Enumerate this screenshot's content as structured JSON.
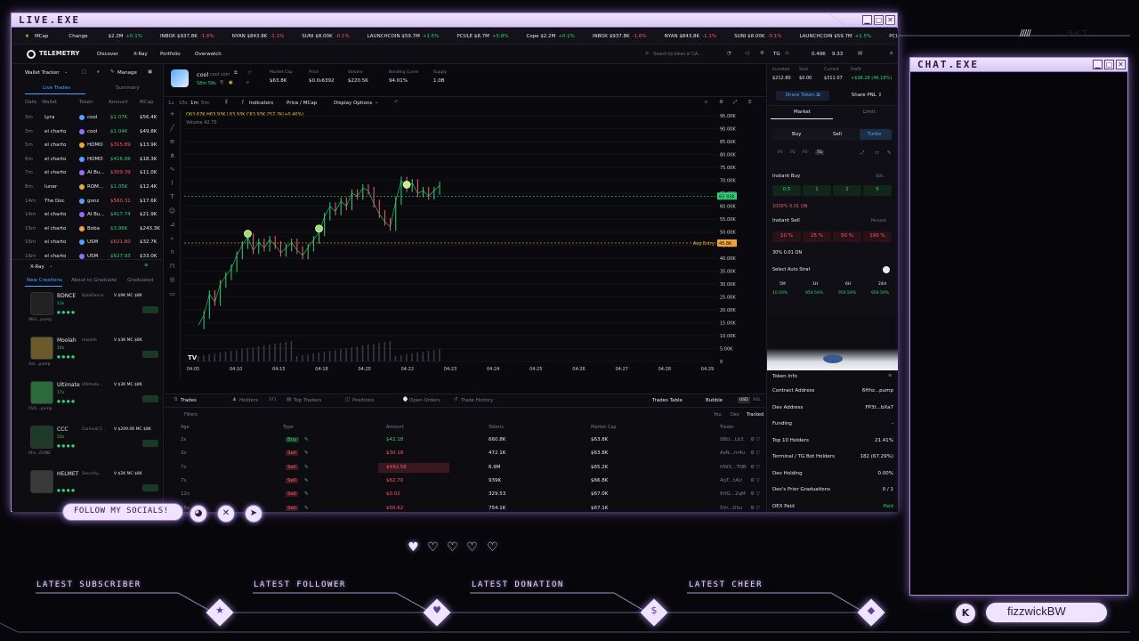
{
  "overlay": {
    "main_title": "LIVE.EXE",
    "chat_title": "CHAT.EXE",
    "follow_label": "FOLLOW MY SOCIALS!",
    "latest_subscriber": "LATEST SUBSCRIBER",
    "latest_follower": "LATEST FOLLOWER",
    "latest_donation": "LATEST DONATION",
    "latest_cheer": "LATEST CHEER",
    "username": "fizzwickBW",
    "deco_text": "ライブ"
  },
  "ticker": {
    "items": [
      {
        "label": "MCap",
        "val": ""
      },
      {
        "label": "Change",
        "val": ""
      },
      {
        "label": "$2.2M",
        "val": "+0.1%",
        "dir": "up"
      },
      {
        "label": "INBOX $937.8K",
        "val": "-1.6%",
        "dir": "dn"
      },
      {
        "label": "NYAN $843.8K",
        "val": "-1.1%",
        "dir": "dn"
      },
      {
        "label": "SUNI $8.00K",
        "val": "-0.1%",
        "dir": "dn"
      },
      {
        "label": "LAUNCHCOIN $59.7M",
        "val": "+1.5%",
        "dir": "up"
      },
      {
        "label": "PCULE $8.7M",
        "val": "+5.8%",
        "dir": "up"
      },
      {
        "label": "Cope $2.2M",
        "val": "+0.1%",
        "dir": "up"
      },
      {
        "label": "INBOX $937.8K",
        "val": "-1.6%",
        "dir": "dn"
      },
      {
        "label": "NYAN $843.8K",
        "val": "-1.1%",
        "dir": "dn"
      },
      {
        "label": "SUNI $8.00K",
        "val": "-0.1%",
        "dir": "dn"
      },
      {
        "label": "LAUNCHCOIN $59.7M",
        "val": "+1.5%",
        "dir": "up"
      },
      {
        "label": "PCULE $8.7M",
        "val": "+5.8%",
        "dir": "up"
      }
    ]
  },
  "nav": {
    "brand": "TELEMETRY",
    "links": [
      "Discover",
      "X-Ray",
      "Portfolio",
      "Overwatch"
    ],
    "search_placeholder": "Search by token or CA...",
    "tg": "TG",
    "balance": "0.496",
    "balance2": "9.33"
  },
  "wallet": {
    "title": "Wallet Tracker",
    "manage": "Manage",
    "tabs": [
      "Live Trades",
      "Summary"
    ],
    "headers": [
      "Date",
      "Wallet",
      "Token",
      "Amount",
      "MCap"
    ],
    "rows": [
      {
        "date": "3m",
        "wallet": "Lyra",
        "token": "cool",
        "amount": "$1.07K",
        "mcap": "$56.4K",
        "dir": "up"
      },
      {
        "date": "3m",
        "wallet": "el charto",
        "token": "cool",
        "amount": "$1.04K",
        "mcap": "$49.8K",
        "dir": "up"
      },
      {
        "date": "5m",
        "wallet": "el charto",
        "token": "HOMO",
        "amount": "$315.89",
        "mcap": "$13.9K",
        "dir": "dn"
      },
      {
        "date": "6m",
        "wallet": "el charto",
        "token": "HOMO",
        "amount": "$416.86",
        "mcap": "$18.3K",
        "dir": "up"
      },
      {
        "date": "7m",
        "wallet": "el charto",
        "token": "AI Bu...",
        "amount": "$309.39",
        "mcap": "$11.0K",
        "dir": "dn"
      },
      {
        "date": "8m",
        "wallet": "luner",
        "token": "ROM...",
        "amount": "$1.05K",
        "mcap": "$12.4K",
        "dir": "up"
      },
      {
        "date": "14m",
        "wallet": "The Doc",
        "token": "gonz",
        "amount": "$560.31",
        "mcap": "$17.6K",
        "dir": "dn"
      },
      {
        "date": "14m",
        "wallet": "el charto",
        "token": "AI Bu...",
        "amount": "$417.74",
        "mcap": "$21.9K",
        "dir": "up"
      },
      {
        "date": "15m",
        "wallet": "el charto",
        "token": "Boba",
        "amount": "$3.96K",
        "mcap": "$243.3K",
        "dir": "up"
      },
      {
        "date": "16m",
        "wallet": "el charto",
        "token": "USM",
        "amount": "$621.80",
        "mcap": "$32.7K",
        "dir": "dn"
      },
      {
        "date": "16m",
        "wallet": "el charto",
        "token": "USM",
        "amount": "$627.93",
        "mcap": "$33.0K",
        "dir": "up"
      }
    ]
  },
  "xray": {
    "title": "X-Ray",
    "tabs": [
      "New Creations",
      "About to Graduate",
      "Graduated"
    ],
    "items": [
      {
        "name": "BDNCE",
        "sub": "ByteDance",
        "stats": "V $9K  MC $8K",
        "age": "13s",
        "foot": "9KU...pump"
      },
      {
        "name": "Moolah",
        "sub": "moolah",
        "stats": "V $3K  MC $8K",
        "age": "14s",
        "foot": "Ast...pump"
      },
      {
        "name": "Ultimate",
        "sub": "Ultimate...",
        "stats": "V $3K  MC $8K",
        "age": "17s",
        "foot": "5VU...pump"
      },
      {
        "name": "CCC",
        "sub": "Carnival C...",
        "stats": "V $209.0K  MC $8K",
        "age": "52s",
        "foot": "0Fe...RONE"
      },
      {
        "name": "HELMET",
        "sub": "Security...",
        "stats": "V $2K  MC $8K",
        "age": "",
        "foot": ""
      }
    ]
  },
  "token": {
    "name": "cool",
    "ticker": "cool coin",
    "age": "58m 58s",
    "stats": [
      {
        "label": "Market Cap",
        "value": "$63.8K"
      },
      {
        "label": "Price",
        "value": "$0.0₅6392"
      },
      {
        "label": "Volume",
        "value": "$220.5K"
      },
      {
        "label": "Bonding Curve",
        "value": "94.01%"
      },
      {
        "label": "Supply",
        "value": "1.0B"
      }
    ]
  },
  "chart_toolbar": {
    "intervals": [
      "1s",
      "15s",
      "1m",
      "5m"
    ],
    "indicators": "Indicators",
    "price_mcap": "Price / MCap",
    "display_options": "Display Options"
  },
  "chart_data": {
    "type": "line",
    "legend": "O63.67K H63.93K L63.93K C63.93K 257.2K(+0.40%)",
    "volume_label": "Volume  42.75",
    "x_ticks": [
      "04:05",
      "04:10",
      "04:15",
      "04:18",
      "04:20",
      "04:22",
      "04:23",
      "04:24",
      "04:25",
      "04:26",
      "04:27",
      "04:28",
      "04:29"
    ],
    "y_ticks": [
      "95.00K",
      "90.00K",
      "85.00K",
      "80.00K",
      "75.00K",
      "70.00K",
      "65.00K",
      "60.00K",
      "55.00K",
      "50.00K",
      "45.00K",
      "40.00K",
      "35.00K",
      "30.00K",
      "25.00K",
      "20.00K",
      "15.00K",
      "10.00K",
      "5.00K",
      "0"
    ],
    "ylim": [
      0,
      95000
    ],
    "current_price_label": "63.93K",
    "avg_entry_label": "Avg Entry",
    "avg_entry_value": "45.8K",
    "series": [
      {
        "values": [
          14000,
          18000,
          26000,
          23000,
          30000,
          33000,
          36000,
          41000,
          45000,
          48000,
          43000,
          46000,
          44000,
          47000,
          45000,
          42000,
          44000,
          46000,
          43000,
          41000,
          44000,
          47000,
          50000,
          56000,
          60000,
          58000,
          62000,
          60000,
          65000,
          64000,
          67000,
          66000,
          61000,
          57000,
          54000,
          52000,
          62000,
          70000,
          67000,
          69000,
          65000,
          66000,
          64000,
          66000,
          68000
        ]
      }
    ]
  },
  "trades": {
    "tabs": [
      "Trades",
      "Holders",
      "Top Traders",
      "Positions",
      "Open Orders",
      "Trade History"
    ],
    "holders_count": "371",
    "right_tabs": [
      "Trades Table",
      "Bubble"
    ],
    "currency": [
      "USD",
      "SOL"
    ],
    "filters_label": "Filters",
    "filter_btns": [
      "You",
      "Dev",
      "Tracked"
    ],
    "headers": [
      "Age",
      "Type",
      "Amount",
      "Tokens",
      "Market Cap",
      "Trader"
    ],
    "rows": [
      {
        "age": "2s",
        "type": "Buy",
        "amount": "$42.18",
        "tokens": "660.8K",
        "mcap": "$63.8K",
        "trader": "9BU...Lb3",
        "dir": "up"
      },
      {
        "age": "3s",
        "type": "Sell",
        "amount": "$30.18",
        "tokens": "472.1K",
        "mcap": "$63.8K",
        "trader": "AsN...m4u",
        "dir": "dn"
      },
      {
        "age": "7s",
        "type": "Sell",
        "amount": "$442.58",
        "tokens": "6.9M",
        "mcap": "$65.2K",
        "trader": "HWX...TNB",
        "dir": "dn"
      },
      {
        "age": "7s",
        "type": "Sell",
        "amount": "$62.70",
        "tokens": "939K",
        "mcap": "$66.8K",
        "trader": "4qT...tAU",
        "dir": "dn"
      },
      {
        "age": "12s",
        "type": "Sell",
        "amount": "$0.02",
        "tokens": "329.53",
        "mcap": "$67.0K",
        "trader": "6HG...2qM",
        "dir": "dn"
      },
      {
        "age": "15s",
        "type": "Sell",
        "amount": "$50.62",
        "tokens": "754.1K",
        "mcap": "$67.1K",
        "trader": "5Vr...DSu",
        "dir": "dn"
      }
    ]
  },
  "side": {
    "invested_label": "Invested",
    "invested": "$212.80",
    "sold_label": "Sold",
    "sold": "$0.00",
    "current_label": "Current",
    "current": "$311.07",
    "profit_label": "Profit",
    "profit": "+$98.28 (46.18%)",
    "share_token": "Share Token",
    "share_pnl": "Share PNL",
    "order_tabs": [
      "Market",
      "Limit"
    ],
    "modes": [
      "Buy",
      "Sell",
      "Turbo"
    ],
    "presets": [
      "P1",
      "P2",
      "P3",
      "TG"
    ],
    "instant_buy": "Instant Buy",
    "buy_amounts": [
      "0.5",
      "1",
      "2",
      "5"
    ],
    "buy_opts": "1000% 0.01 ON",
    "instant_sell": "Instant Sell",
    "percent": "Percent",
    "sell_amounts": [
      "10 %",
      "25 %",
      "50 %",
      "100 %"
    ],
    "sell_opts": "30% 0.01 ON",
    "auto_strat": "Select Auto Strat",
    "periods": [
      "5M",
      "1H",
      "6H",
      "24H"
    ],
    "period_vals": [
      "10.59%",
      "959.59%",
      "959.59%",
      "959.59%"
    ],
    "token_info": "Token Info",
    "info": [
      {
        "label": "Contract Address",
        "value": "6Hhz...pump"
      },
      {
        "label": "Dev Address",
        "value": "FP3t...bXa7"
      },
      {
        "label": "Funding",
        "value": "-"
      },
      {
        "label": "Top 10 Holders",
        "value": "21.41%"
      },
      {
        "label": "Terminal / TG Bot Holders",
        "value": "182 (67.29%)"
      },
      {
        "label": "Dev Holding",
        "value": "0.00%"
      },
      {
        "label": "Dev's Prior Graduations",
        "value": "0 / 1"
      },
      {
        "label": "DEX Paid",
        "value": "Paid"
      }
    ]
  }
}
